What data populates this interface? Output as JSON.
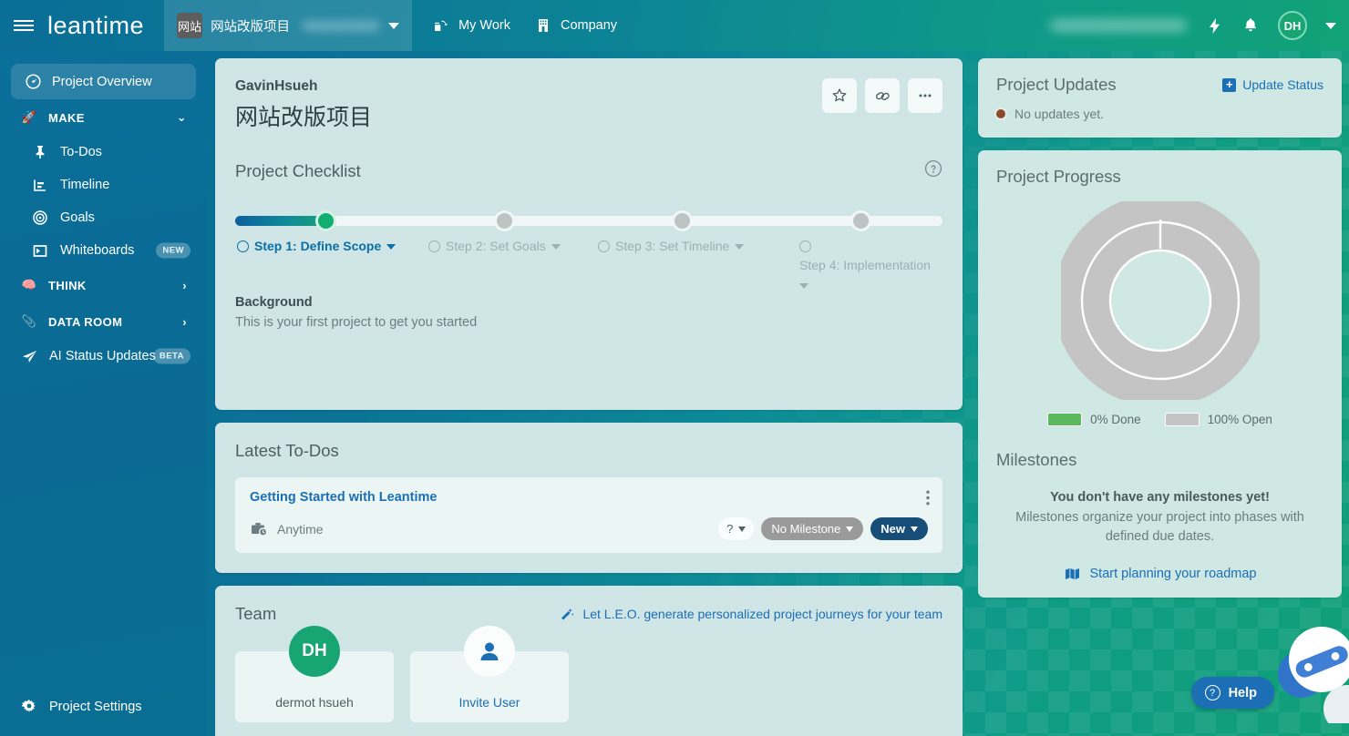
{
  "topbar": {
    "menu_icon": "hamburger-icon",
    "brand": "leantime",
    "project_tab": {
      "avatar_label": "网站",
      "name": "网站改版项目"
    },
    "nav": [
      {
        "label": "My Work",
        "icon": "my-work-icon"
      },
      {
        "label": "Company",
        "icon": "building-icon"
      }
    ],
    "quick_icon": "lightning-icon",
    "notifications_icon": "bell-icon",
    "user_initials": "DH"
  },
  "sidebar": {
    "overview": {
      "label": "Project Overview",
      "icon": "dashboard-icon"
    },
    "groups": [
      {
        "label": "MAKE",
        "icon": "rocket-icon",
        "chevron": "chevron-down"
      },
      {
        "label": "THINK",
        "icon": "brain-icon",
        "chevron": "chevron-right"
      },
      {
        "label": "DATA ROOM",
        "icon": "paperclip-icon",
        "chevron": "chevron-right"
      }
    ],
    "make_items": [
      {
        "label": "To-Dos",
        "icon": "pin-icon",
        "badge": ""
      },
      {
        "label": "Timeline",
        "icon": "timeline-icon",
        "badge": ""
      },
      {
        "label": "Goals",
        "icon": "target-icon",
        "badge": ""
      },
      {
        "label": "Whiteboards",
        "icon": "whiteboard-icon",
        "badge": "NEW"
      }
    ],
    "ai_status": {
      "label": "AI Status Updates",
      "icon": "paper-plane-icon",
      "badge": "BETA"
    },
    "settings": {
      "label": "Project Settings",
      "icon": "gear-icon"
    }
  },
  "hero": {
    "owner": "GavinHsueh",
    "title": "网站改版项目",
    "actions": [
      {
        "name": "star-icon",
        "glyph": "☆"
      },
      {
        "name": "link-icon",
        "glyph": "🔗"
      },
      {
        "name": "ellipsis-icon",
        "glyph": "•••"
      }
    ]
  },
  "checklist": {
    "title": "Project Checklist",
    "help_icon": "question-circle-icon",
    "progress_percent": 12,
    "steps": [
      {
        "label": "Step 1: Define Scope",
        "state": "active"
      },
      {
        "label": "Step 2: Set Goals",
        "state": "pending"
      },
      {
        "label": "Step 3: Set Timeline",
        "state": "pending"
      },
      {
        "label": "Step 4: Implementation",
        "state": "pending"
      }
    ],
    "background_label": "Background",
    "background_text": "This is your first project to get you started"
  },
  "todos": {
    "title": "Latest To-Dos",
    "items": [
      {
        "name": "Getting Started with Leantime",
        "when": "Anytime",
        "when_icon": "briefcase-clock-icon",
        "priority_badge": "?",
        "milestone_badge": "No Milestone",
        "status_badge": "New",
        "menu_icon": "kebab-icon"
      }
    ]
  },
  "team": {
    "title": "Team",
    "leo_link": "Let L.E.O. generate personalized project journeys for your team",
    "leo_icon": "magic-wand-icon",
    "members": [
      {
        "initials": "DH",
        "name": "dermot hsueh",
        "type": "member"
      },
      {
        "initials": "",
        "name": "Invite User",
        "type": "invite",
        "icon": "user-icon"
      }
    ]
  },
  "project_updates": {
    "title": "Project Updates",
    "action_label": "Update Status",
    "action_icon": "plus-box-icon",
    "empty_text": "No updates yet."
  },
  "project_progress": {
    "title": "Project Progress"
  },
  "chart_data": {
    "type": "pie",
    "title": "Project Progress",
    "categories": [
      "Done",
      "Open"
    ],
    "values": [
      0,
      100
    ],
    "labels": [
      "0% Done",
      "100% Open"
    ],
    "colors": [
      "#5cb85c",
      "#c4c4c4"
    ],
    "legend_position": "bottom",
    "donut": true
  },
  "milestones": {
    "title": "Milestones",
    "empty_title": "You don't have any milestones yet!",
    "empty_text": "Milestones organize your project into phases with defined due dates.",
    "link": "Start planning your roadmap",
    "link_icon": "map-icon"
  },
  "help": {
    "label": "Help",
    "icon": "question-circle-icon"
  },
  "bot": {
    "icon": "chat-bot-icon"
  },
  "colors": {
    "brand_teal": "#0c8396",
    "accent_green": "#12ad72",
    "link_blue": "#1c6fb5",
    "card_bg": "#cfe5e6"
  }
}
